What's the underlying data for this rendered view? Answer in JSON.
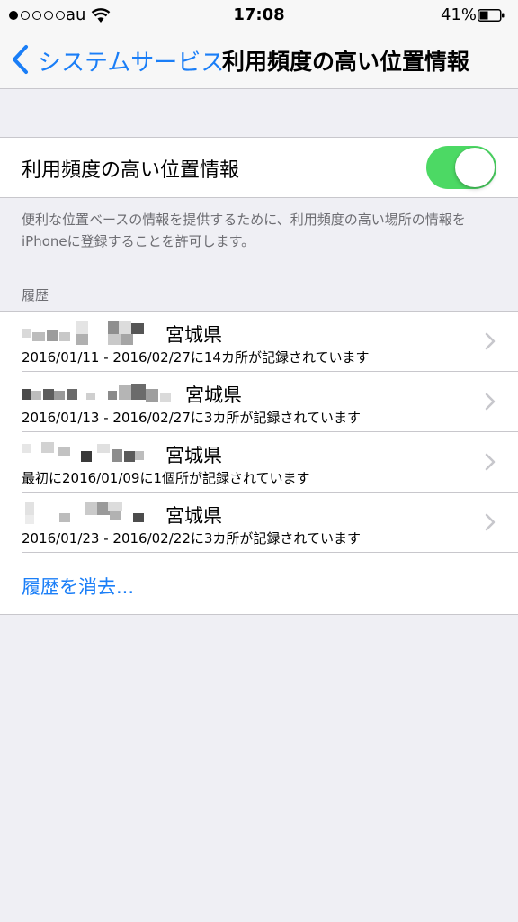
{
  "status_bar": {
    "carrier": "au",
    "time": "17:08",
    "battery_percent": "41%",
    "signal_strength": 1,
    "battery_level": 0.41
  },
  "nav": {
    "back_label": "システムサービス",
    "title": "利用頻度の高い位置情報"
  },
  "toggle": {
    "label": "利用頻度の高い位置情報",
    "on": true
  },
  "description": "便利な位置ベースの情報を提供するために、利用頻度の高い場所の情報をiPhoneに登録することを許可します。",
  "history": {
    "header": "履歴",
    "items": [
      {
        "place": "宮城県",
        "detail": "2016/01/11 - 2016/02/27に14カ所が記録されています"
      },
      {
        "place": "宮城県",
        "detail": "2016/01/13 - 2016/02/27に3カ所が記録されています"
      },
      {
        "place": "宮城県",
        "detail": "最初に2016/01/09に1個所が記録されています"
      },
      {
        "place": "宮城県",
        "detail": "2016/01/23 - 2016/02/22に3カ所が記録されています"
      }
    ],
    "clear_label": "履歴を消去..."
  },
  "colors": {
    "accent": "#1a7ef7",
    "switch_on": "#4cd964",
    "background": "#efeff4"
  }
}
